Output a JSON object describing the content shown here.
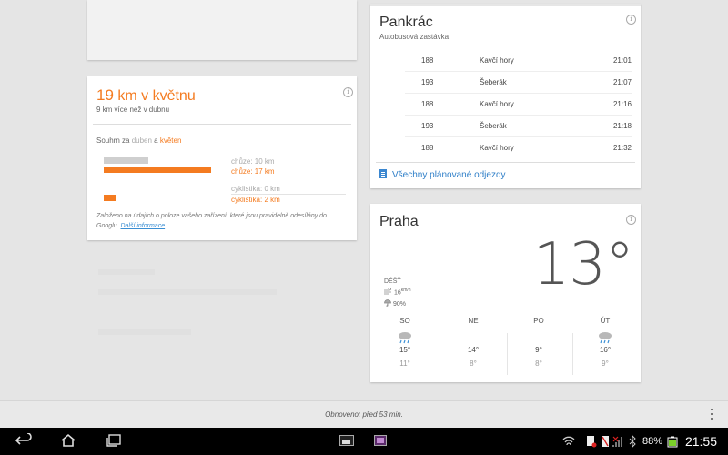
{
  "stats": {
    "title_num": "19",
    "title_rest": " km v květnu",
    "subtitle": "9 km více než v dubnu",
    "summary_prefix": "Souhrn za ",
    "month1": "duben",
    "and": " a ",
    "month2": "květen",
    "walk_prev": "chůze: 10 km",
    "walk_curr": "chůze: 17 km",
    "bike_prev": "cyklistika: 0 km",
    "bike_curr": "cyklistika: 2 km",
    "footer": "Založeno na údajích o poloze vašeho zařízení, které jsou pravidelně odesílány do Googlu. ",
    "more_link": "Další informace",
    "values": {
      "walk_prev_km": 10,
      "walk_curr_km": 17,
      "bike_prev_km": 0,
      "bike_curr_km": 2
    }
  },
  "transit": {
    "title": "Pankrác",
    "subtitle": "Autobusová zastávka",
    "departures": [
      {
        "line": "188",
        "dest": "Kavčí hory",
        "time": "21:01"
      },
      {
        "line": "193",
        "dest": "Šeberák",
        "time": "21:07"
      },
      {
        "line": "188",
        "dest": "Kavčí hory",
        "time": "21:16"
      },
      {
        "line": "193",
        "dest": "Šeberák",
        "time": "21:18"
      },
      {
        "line": "188",
        "dest": "Kavčí hory",
        "time": "21:32"
      }
    ],
    "all_link": "Všechny plánované odjezdy"
  },
  "weather": {
    "city": "Praha",
    "temp": "13°",
    "condition": "DÉŠŤ",
    "wind": "16",
    "wind_unit": "km/h",
    "humidity": "90%",
    "forecast": [
      {
        "day": "SO",
        "hi": "15°",
        "lo": "11°",
        "icon": "rain-icon"
      },
      {
        "day": "NE",
        "hi": "14°",
        "lo": "8°",
        "icon": "none"
      },
      {
        "day": "PO",
        "hi": "9°",
        "lo": "8°",
        "icon": "none"
      },
      {
        "day": "ÚT",
        "hi": "16°",
        "lo": "9°",
        "icon": "rain-icon"
      }
    ]
  },
  "refresh": {
    "text": "Obnoveno: před 53 min."
  },
  "status": {
    "battery": "88%",
    "time": "21:55"
  },
  "colors": {
    "accent": "#f47b20",
    "link": "#2f7fc8"
  }
}
